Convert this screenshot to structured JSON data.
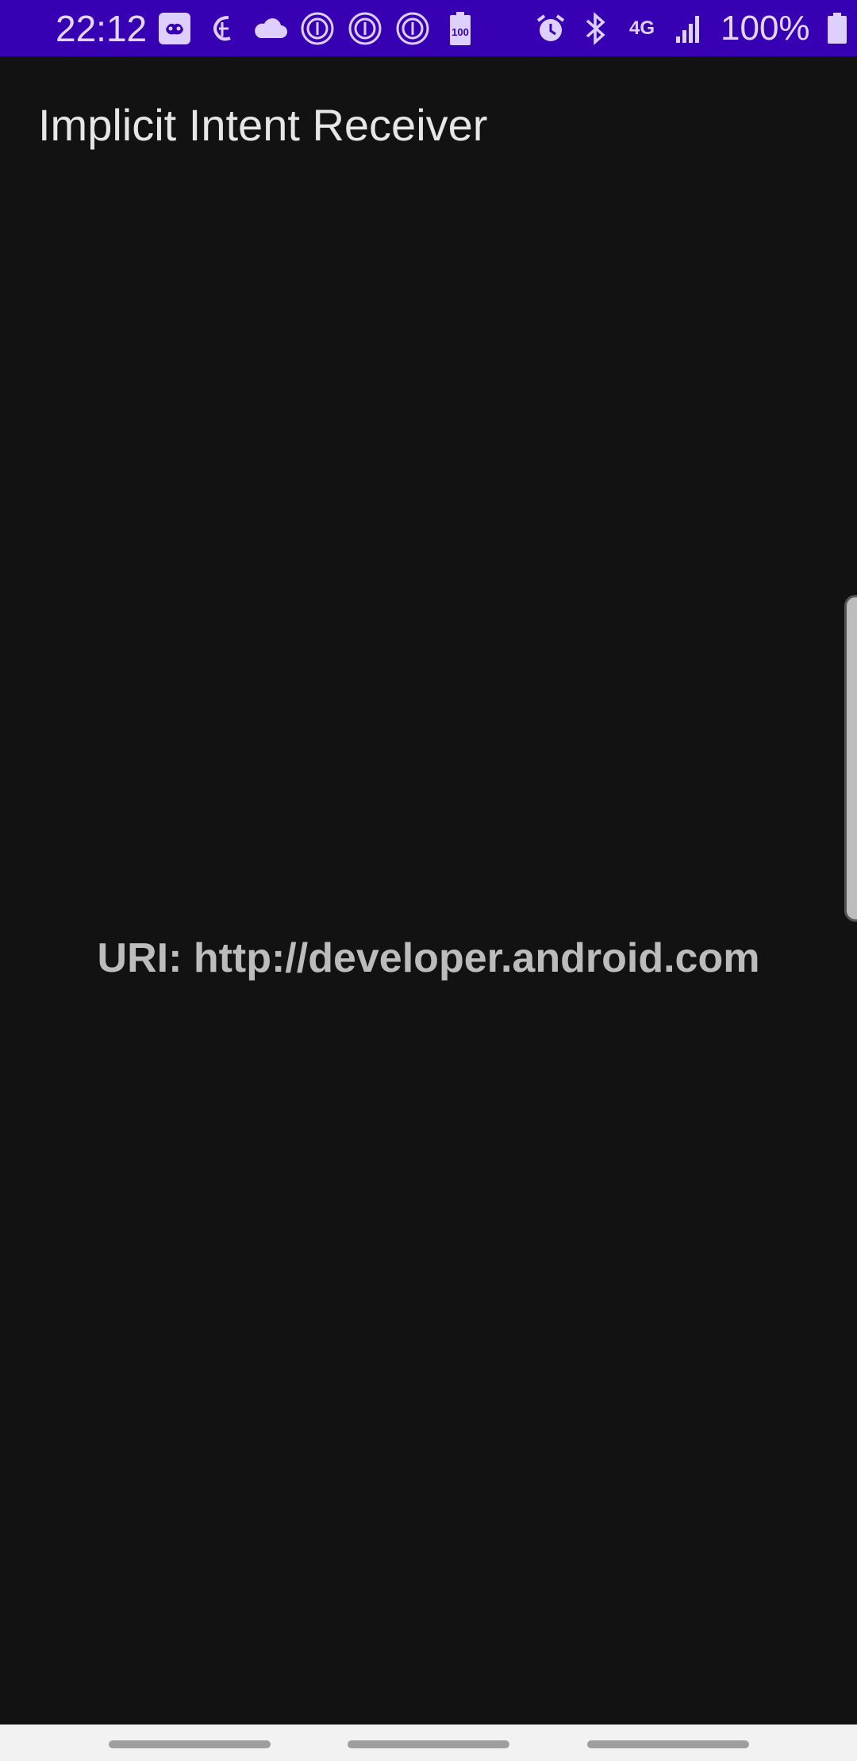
{
  "status_bar": {
    "time": "22:12",
    "battery_percent": "100%",
    "badge_text": "100",
    "network_label": "4G",
    "left_icons": [
      "game-controller-icon",
      "nyt-icon",
      "cloud-icon",
      "fingerprint-icon",
      "fingerprint-icon",
      "fingerprint-icon",
      "battery-saver-icon"
    ],
    "right_icons": [
      "alarm-icon",
      "bluetooth-icon",
      "4g-icon",
      "signal-icon",
      "battery-icon"
    ],
    "background_color": "#3700b3",
    "icon_color": "#ddd0ff"
  },
  "app": {
    "title": "Implicit Intent Receiver",
    "uri_label": "URI: http://developer.android.com",
    "background_color": "#121212"
  },
  "nav_bar": {
    "items": [
      "recent-apps-pill",
      "home-pill",
      "back-pill"
    ]
  }
}
